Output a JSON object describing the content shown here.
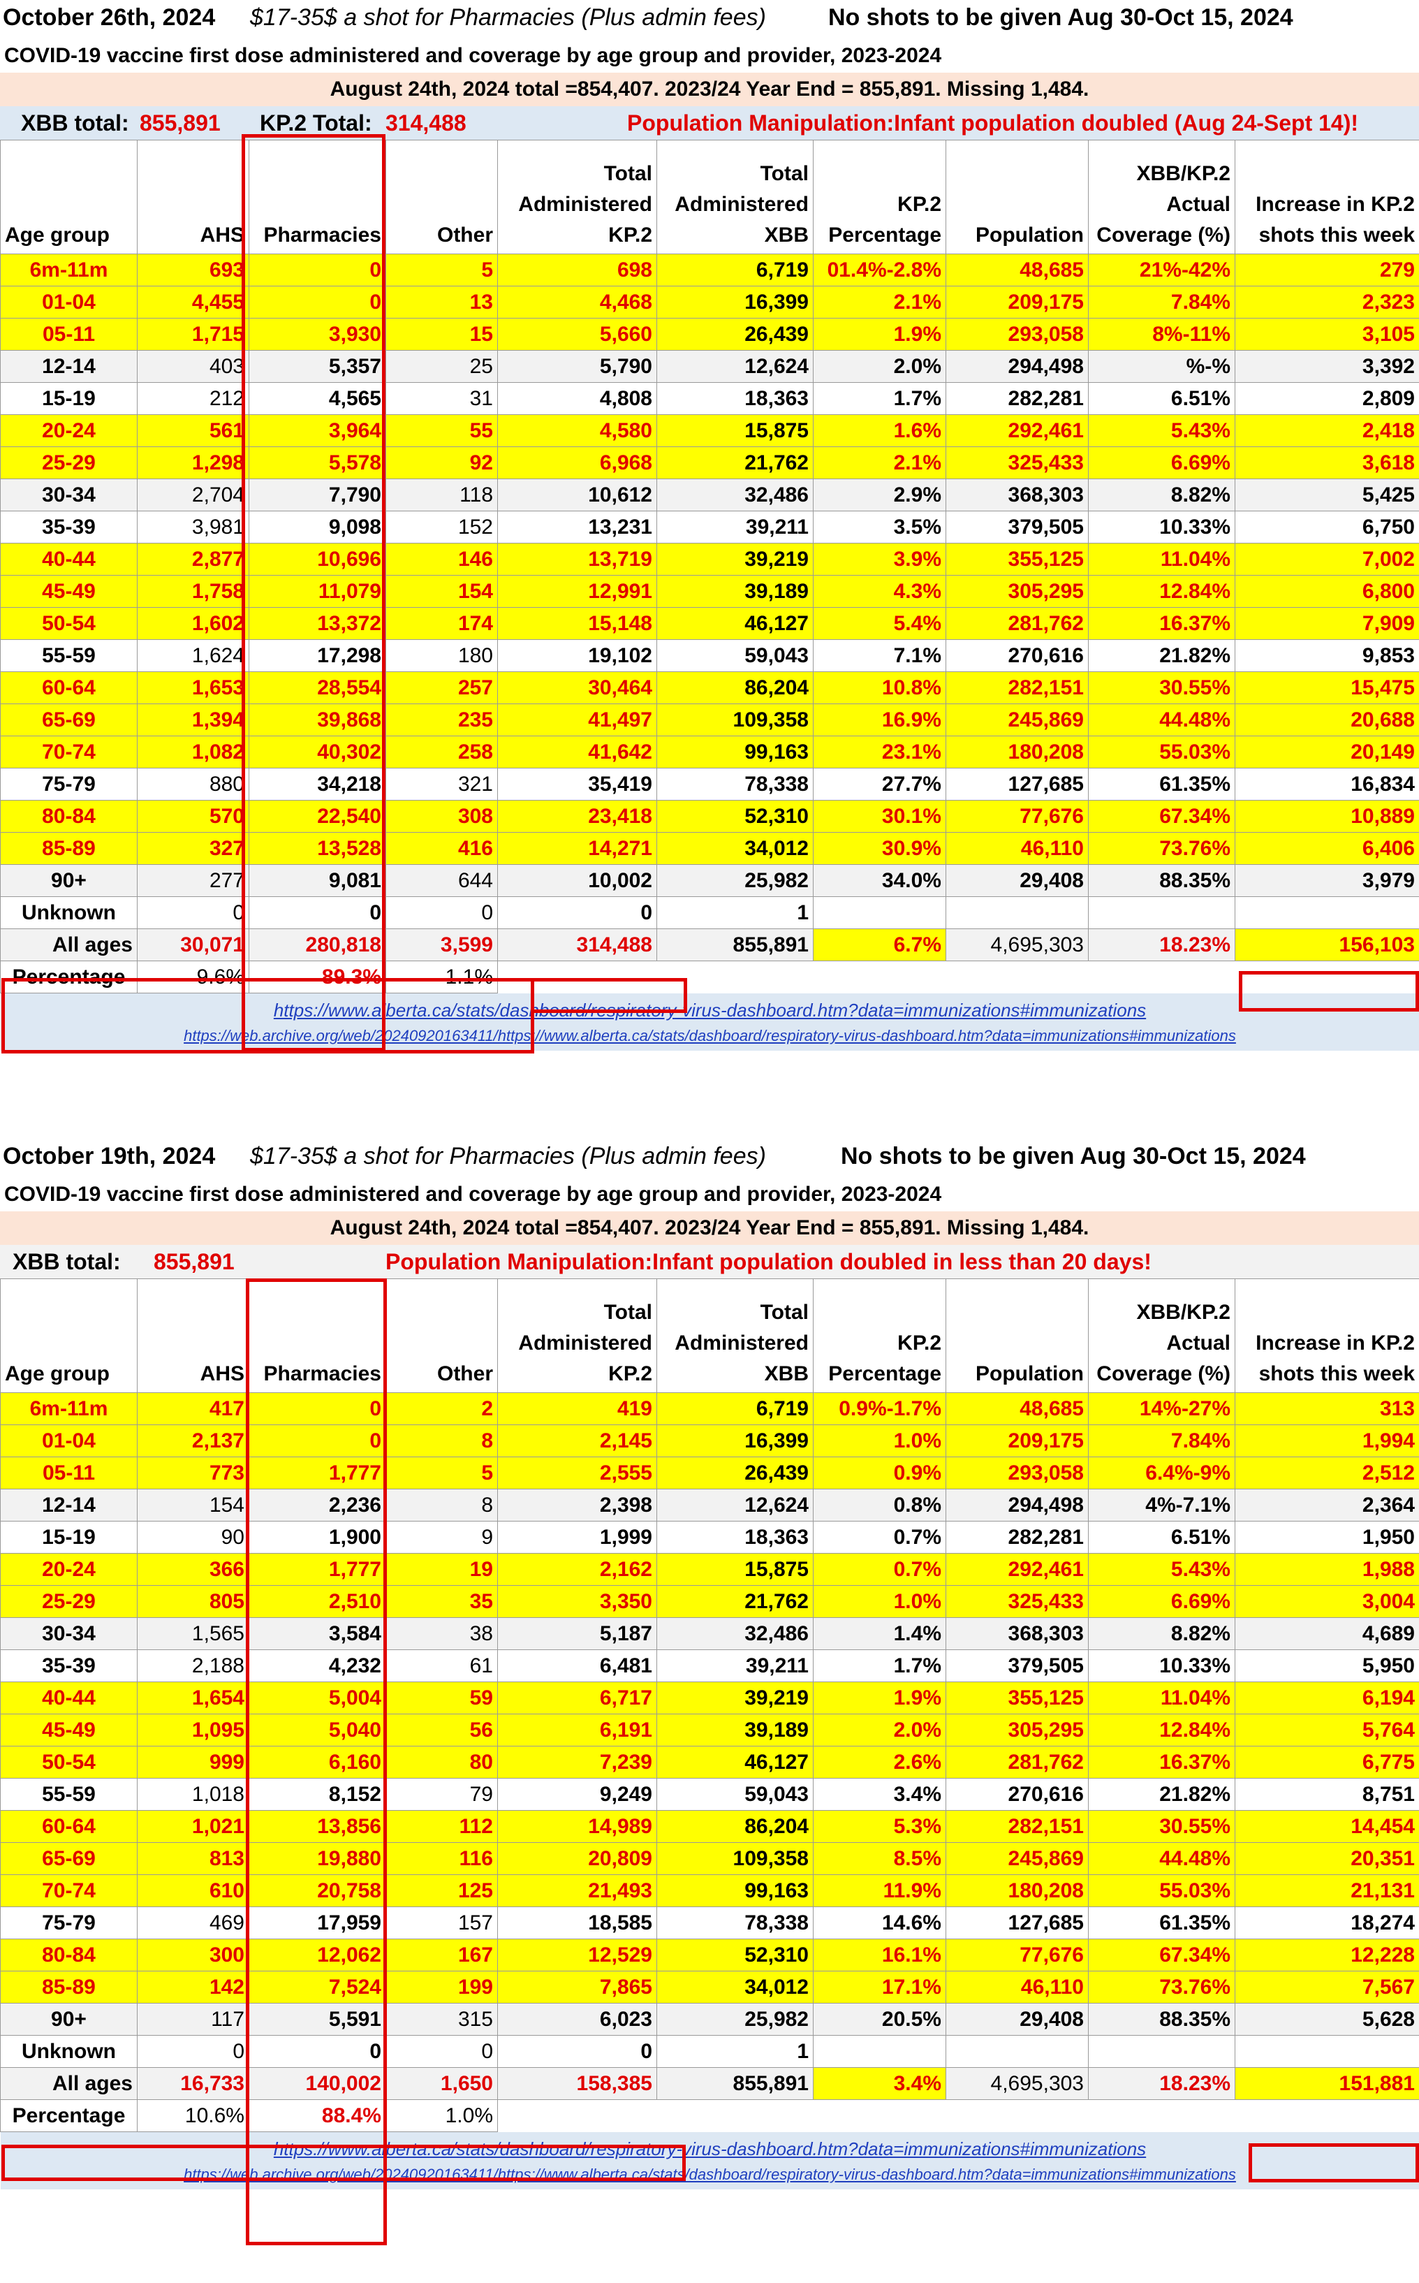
{
  "columns": [
    "Age group",
    "AHS",
    "Pharmacies",
    "Other",
    "Total Administered KP.2",
    "Total Administered XBB",
    "KP.2 Percentage",
    "Population",
    "XBB/KP.2 Actual Coverage (%)",
    "Increase in KP.2 shots this week"
  ],
  "age_groups": [
    "6m-11m",
    "01-04",
    "05-11",
    "12-14",
    "15-19",
    "20-24",
    "25-29",
    "30-34",
    "35-39",
    "40-44",
    "45-49",
    "50-54",
    "55-59",
    "60-64",
    "65-69",
    "70-74",
    "75-79",
    "80-84",
    "85-89",
    "90+",
    "Unknown"
  ],
  "xbb": [
    "6,719",
    "16,399",
    "26,439",
    "12,624",
    "18,363",
    "15,875",
    "21,762",
    "32,486",
    "39,211",
    "39,219",
    "39,189",
    "46,127",
    "59,043",
    "86,204",
    "109,358",
    "99,163",
    "78,338",
    "52,310",
    "34,012",
    "25,982",
    "1"
  ],
  "population": [
    "48,685",
    "209,175",
    "293,058",
    "294,498",
    "282,281",
    "292,461",
    "325,433",
    "368,303",
    "379,505",
    "355,125",
    "305,295",
    "281,762",
    "270,616",
    "282,151",
    "245,869",
    "180,208",
    "127,685",
    "77,676",
    "46,110",
    "29,408",
    ""
  ],
  "panels": [
    {
      "date": "October 26th, 2024",
      "price": "$17-35$ a shot for Pharmacies (Plus admin fees)",
      "no_shots": "No shots to be given Aug 30-Oct 15, 2024",
      "subtitle": "COVID-19 vaccine first dose administered and coverage by age group and provider, 2023-2024",
      "aug": "August 24th, 2024 total =854,407. 2023/24 Year End = 855,891. Missing 1,484.",
      "xbb_total_label": "XBB total:",
      "xbb_total": "855,891",
      "kp2_total_label": "KP.2 Total:",
      "kp2_total": "314,488",
      "manipulation": "Population Manipulation:Infant population doubled (Aug 24-Sept 14)!",
      "ahs": [
        "693",
        "4,455",
        "1,715",
        "403",
        "212",
        "561",
        "1,298",
        "2,704",
        "3,981",
        "2,877",
        "1,758",
        "1,602",
        "1,624",
        "1,653",
        "1,394",
        "1,082",
        "880",
        "570",
        "327",
        "277",
        "0"
      ],
      "pharmacies": [
        "0",
        "0",
        "3,930",
        "5,357",
        "4,565",
        "3,964",
        "5,578",
        "7,790",
        "9,098",
        "10,696",
        "11,079",
        "13,372",
        "17,298",
        "28,554",
        "39,868",
        "40,302",
        "34,218",
        "22,540",
        "13,528",
        "9,081",
        "0"
      ],
      "other": [
        "5",
        "13",
        "15",
        "25",
        "31",
        "55",
        "92",
        "118",
        "152",
        "146",
        "154",
        "174",
        "180",
        "257",
        "235",
        "258",
        "321",
        "308",
        "416",
        "644",
        "0"
      ],
      "kp2": [
        "698",
        "4,468",
        "5,660",
        "5,790",
        "4,808",
        "4,580",
        "6,968",
        "10,612",
        "13,231",
        "13,719",
        "12,991",
        "15,148",
        "19,102",
        "30,464",
        "41,497",
        "41,642",
        "35,419",
        "23,418",
        "14,271",
        "10,002",
        "0"
      ],
      "kp2_pct": [
        "01.4%-2.8%",
        "2.1%",
        "1.9%",
        "2.0%",
        "1.7%",
        "1.6%",
        "2.1%",
        "2.9%",
        "3.5%",
        "3.9%",
        "4.3%",
        "5.4%",
        "7.1%",
        "10.8%",
        "16.9%",
        "23.1%",
        "27.7%",
        "30.1%",
        "30.9%",
        "34.0%",
        ""
      ],
      "coverage": [
        "21%-42%",
        "7.84%",
        "8%-11%",
        "%-%",
        "6.51%",
        "5.43%",
        "6.69%",
        "8.82%",
        "10.33%",
        "11.04%",
        "12.84%",
        "16.37%",
        "21.82%",
        "30.55%",
        "44.48%",
        "55.03%",
        "61.35%",
        "67.34%",
        "73.76%",
        "88.35%",
        ""
      ],
      "increase": [
        "279",
        "2,323",
        "3,105",
        "3,392",
        "2,809",
        "2,418",
        "3,618",
        "5,425",
        "6,750",
        "7,002",
        "6,800",
        "7,909",
        "9,853",
        "15,475",
        "20,688",
        "20,149",
        "16,834",
        "10,889",
        "6,406",
        "3,979",
        ""
      ],
      "all_ages": {
        "label": "All ages",
        "ahs": "30,071",
        "pharmacies": "280,818",
        "other": "3,599",
        "kp2": "314,488",
        "xbb": "855,891",
        "kp2_pct": "6.7%",
        "population": "4,695,303",
        "coverage": "18.23%",
        "increase": "156,103"
      },
      "percentage": {
        "label": "Percentage",
        "ahs": "9.6%",
        "pharmacies": "89.3%",
        "other": "1.1%"
      },
      "link1": "https://www.alberta.ca/stats/dashboard/respiratory-virus-dashboard.htm?data=immunizations#immunizations",
      "link2": "https://web.archive.org/web/20240920163411/https://www.alberta.ca/stats/dashboard/respiratory-virus-dashboard.htm?data=immunizations#immunizations"
    },
    {
      "date": "October 19th, 2024",
      "price": "$17-35$ a shot for Pharmacies (Plus admin fees)",
      "no_shots": "No shots to be given Aug 30-Oct 15, 2024",
      "subtitle": "COVID-19 vaccine first dose administered and coverage by age group and provider, 2023-2024",
      "aug": "August 24th, 2024 total =854,407. 2023/24 Year End = 855,891. Missing 1,484.",
      "xbb_total_label": "XBB total:",
      "xbb_total": "855,891",
      "kp2_total_label": "",
      "kp2_total": "",
      "manipulation": "Population Manipulation:Infant population doubled in less than 20 days!",
      "ahs": [
        "417",
        "2,137",
        "773",
        "154",
        "90",
        "366",
        "805",
        "1,565",
        "2,188",
        "1,654",
        "1,095",
        "999",
        "1,018",
        "1,021",
        "813",
        "610",
        "469",
        "300",
        "142",
        "117",
        "0"
      ],
      "pharmacies": [
        "0",
        "0",
        "1,777",
        "2,236",
        "1,900",
        "1,777",
        "2,510",
        "3,584",
        "4,232",
        "5,004",
        "5,040",
        "6,160",
        "8,152",
        "13,856",
        "19,880",
        "20,758",
        "17,959",
        "12,062",
        "7,524",
        "5,591",
        "0"
      ],
      "other": [
        "2",
        "8",
        "5",
        "8",
        "9",
        "19",
        "35",
        "38",
        "61",
        "59",
        "56",
        "80",
        "79",
        "112",
        "116",
        "125",
        "157",
        "167",
        "199",
        "315",
        "0"
      ],
      "kp2": [
        "419",
        "2,145",
        "2,555",
        "2,398",
        "1,999",
        "2,162",
        "3,350",
        "5,187",
        "6,481",
        "6,717",
        "6,191",
        "7,239",
        "9,249",
        "14,989",
        "20,809",
        "21,493",
        "18,585",
        "12,529",
        "7,865",
        "6,023",
        "0"
      ],
      "kp2_pct": [
        "0.9%-1.7%",
        "1.0%",
        "0.9%",
        "0.8%",
        "0.7%",
        "0.7%",
        "1.0%",
        "1.4%",
        "1.7%",
        "1.9%",
        "2.0%",
        "2.6%",
        "3.4%",
        "5.3%",
        "8.5%",
        "11.9%",
        "14.6%",
        "16.1%",
        "17.1%",
        "20.5%",
        ""
      ],
      "coverage": [
        "14%-27%",
        "7.84%",
        "6.4%-9%",
        "4%-7.1%",
        "6.51%",
        "5.43%",
        "6.69%",
        "8.82%",
        "10.33%",
        "11.04%",
        "12.84%",
        "16.37%",
        "21.82%",
        "30.55%",
        "44.48%",
        "55.03%",
        "61.35%",
        "67.34%",
        "73.76%",
        "88.35%",
        ""
      ],
      "increase": [
        "313",
        "1,994",
        "2,512",
        "2,364",
        "1,950",
        "1,988",
        "3,004",
        "4,689",
        "5,950",
        "6,194",
        "5,764",
        "6,775",
        "8,751",
        "14,454",
        "20,351",
        "21,131",
        "18,274",
        "12,228",
        "7,567",
        "5,628",
        ""
      ],
      "all_ages": {
        "label": "All ages",
        "ahs": "16,733",
        "pharmacies": "140,002",
        "other": "1,650",
        "kp2": "158,385",
        "xbb": "855,891",
        "kp2_pct": "3.4%",
        "population": "4,695,303",
        "coverage": "18.23%",
        "increase": "151,881"
      },
      "percentage": {
        "label": "Percentage",
        "ahs": "10.6%",
        "pharmacies": "88.4%",
        "other": "1.0%"
      },
      "link1": "https://www.alberta.ca/stats/dashboard/respiratory-virus-dashboard.htm?data=immunizations#immunizations",
      "link2": "https://web.archive.org/web/20240920163411/https://www.alberta.ca/stats/dashboard/respiratory-virus-dashboard.htm?data=immunizations#immunizations"
    }
  ]
}
